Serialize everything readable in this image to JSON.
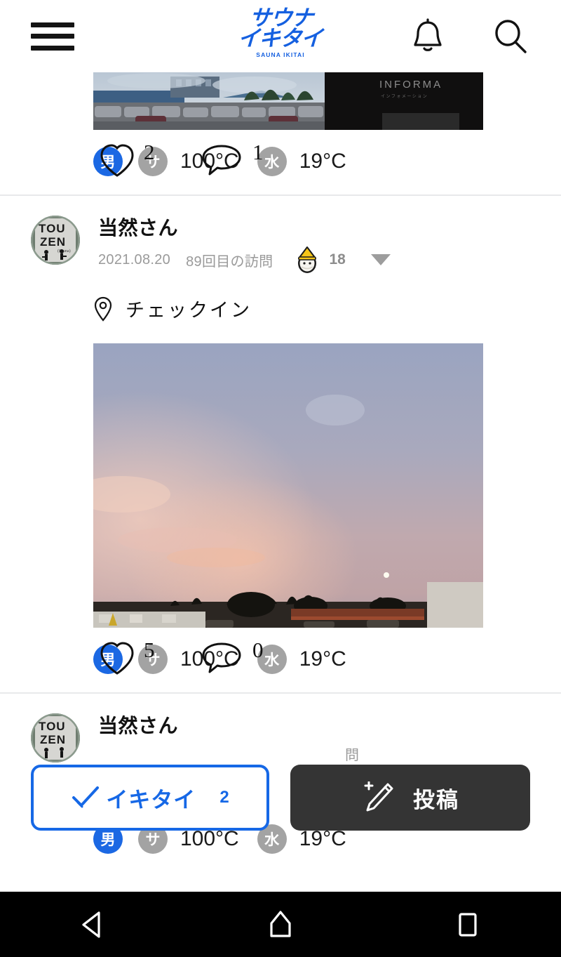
{
  "header": {
    "menu_label": "menu",
    "logo_main": "サウナ\nイキタイ",
    "logo_sub": "SAUNA IKITAI",
    "bell_label": "通知",
    "search_label": "検索",
    "logo_color": "#1560e0"
  },
  "posts": [
    {
      "id": "post-top-partial",
      "photo_caption": "INFORMA",
      "temps": {
        "gender_badge": "男",
        "sauna_badge": "サ",
        "sauna_temp": "100°C",
        "water_badge": "水",
        "water_temp": "19°C"
      },
      "overlay": {
        "like_count": "2",
        "comment_count": "1"
      }
    },
    {
      "id": "post-main",
      "user": {
        "name": "当然さん",
        "avatar_text_line1": "TOU",
        "avatar_text_line2": "ZEN"
      },
      "date": "2021.08.20",
      "visit": "89回目の訪問",
      "totonoi_count": "18",
      "checkin_label": "チェックイン",
      "temps": {
        "gender_badge": "男",
        "sauna_badge": "サ",
        "sauna_temp": "100°C",
        "water_badge": "水",
        "water_temp": "19°C"
      },
      "overlay": {
        "like_count": "5",
        "comment_count": "0"
      }
    },
    {
      "id": "post-bottom-partial",
      "user": {
        "name": "当然さん",
        "avatar_text_line1": "TOU",
        "avatar_text_line2": "ZEN"
      },
      "visit_fragment": "問",
      "temps": {
        "gender_badge": "男",
        "sauna_badge": "サ",
        "sauna_temp": "100°C",
        "water_badge": "水",
        "water_temp": "19°C"
      }
    }
  ],
  "floating_actions": {
    "ikitai_label": "イキタイ",
    "ikitai_count": "2",
    "ikitai_color": "#1668e6",
    "post_label": "投稿",
    "post_bg": "#343434"
  },
  "android_nav": {
    "back_label": "戻る",
    "home_label": "ホーム",
    "recents_label": "履歴"
  },
  "colors": {
    "male_badge": "#1b68e3",
    "gray_badge": "#a3a3a3",
    "divider": "#e8e9eb",
    "meta_text": "#9a9a9a"
  }
}
